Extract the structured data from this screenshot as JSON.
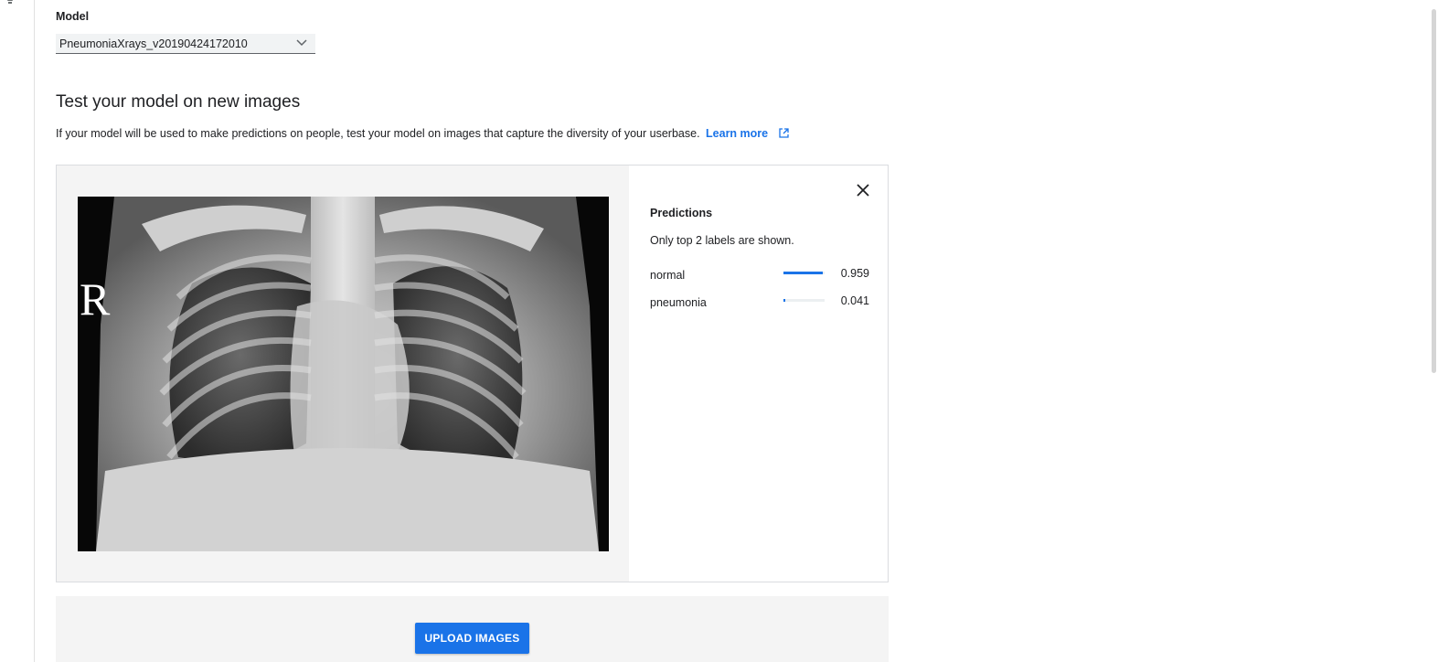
{
  "model": {
    "label": "Model",
    "selected": "PneumoniaXrays_v20190424172010"
  },
  "test": {
    "title": "Test your model on new images",
    "description": "If your model will be used to make predictions on people, test your model on images that capture the diversity of your userbase.",
    "learn_more": "Learn more"
  },
  "image": {
    "marker": "R"
  },
  "predictions": {
    "title": "Predictions",
    "note": "Only top 2 labels are shown.",
    "accent": "#1a73e8",
    "items": [
      {
        "label": "normal",
        "score": "0.959",
        "value": 0.959
      },
      {
        "label": "pneumonia",
        "score": "0.041",
        "value": 0.041
      }
    ]
  },
  "upload": {
    "button": "UPLOAD IMAGES"
  }
}
